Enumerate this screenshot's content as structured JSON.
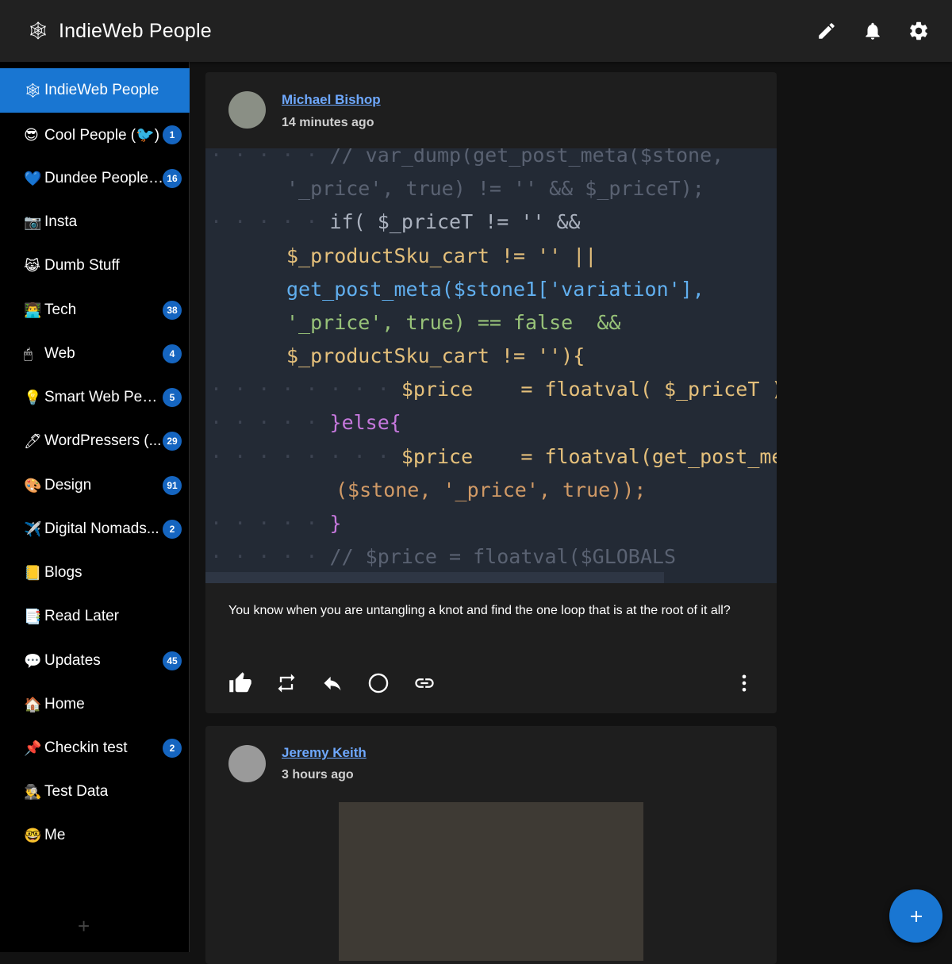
{
  "app": {
    "logo_glyph": "🕸",
    "title": "IndieWeb People"
  },
  "toolbar": {
    "icons": [
      "edit-icon",
      "bell-icon",
      "settings-icon"
    ]
  },
  "sidebar": {
    "items": [
      {
        "emoji": "🕸",
        "label": "IndieWeb People",
        "badge": null,
        "active": true
      },
      {
        "emoji": "😎",
        "label": "Cool People (🐦‍)",
        "badge": "1"
      },
      {
        "emoji": "💙",
        "label": "Dundee People ...",
        "badge": "16"
      },
      {
        "emoji": "📷",
        "label": "Insta",
        "badge": null
      },
      {
        "emoji": "😹",
        "label": "Dumb Stuff",
        "badge": null
      },
      {
        "emoji": "👨‍💻",
        "label": "Tech",
        "badge": "38"
      },
      {
        "emoji": "🖱",
        "label": "Web",
        "badge": "4"
      },
      {
        "emoji": "💡",
        "label": "Smart Web Peop...",
        "badge": "5"
      },
      {
        "emoji": "🖊",
        "label": "WordPressers (...",
        "badge": "29"
      },
      {
        "emoji": "🎨",
        "label": "Design",
        "badge": "91"
      },
      {
        "emoji": "✈️",
        "label": "Digital Nomads...",
        "badge": "2"
      },
      {
        "emoji": "📒",
        "label": "Blogs",
        "badge": null
      },
      {
        "emoji": "📑",
        "label": "Read Later",
        "badge": null
      },
      {
        "emoji": "💬",
        "label": "Updates",
        "badge": "45"
      },
      {
        "emoji": "🏠",
        "label": "Home",
        "badge": null
      },
      {
        "emoji": "📌",
        "label": "Checkin test",
        "badge": "2"
      },
      {
        "emoji": "🕵️‍♂️",
        "label": "Test Data",
        "badge": null
      },
      {
        "emoji": "🤓",
        "label": "Me",
        "badge": null
      }
    ],
    "add_glyph": "+"
  },
  "posts": [
    {
      "author": "Michael Bishop",
      "time": "14 minutes ago",
      "text": "You know when you are untangling a knot and find the one loop that is at the root of it all?",
      "code_lines": [
        "// var_dump(get_post_meta($stone,",
        "'_price', true) != '' && $_priceT);",
        "if( $_priceT != '' &&",
        "$_productSku_cart != '' ||",
        "get_post_meta($stone1['variation'],",
        "'_price', true) == false  &&",
        "$_productSku_cart != ''){",
        "$price    = floatval( $_priceT );",
        "}else{",
        "$price    = floatval(get_post_meta",
        "($stone, '_price', true));",
        "}",
        "// $price = floatval($GLOBALS"
      ]
    },
    {
      "author": "Jeremy Keith",
      "time": "3 hours ago"
    }
  ],
  "fab_glyph": "+"
}
